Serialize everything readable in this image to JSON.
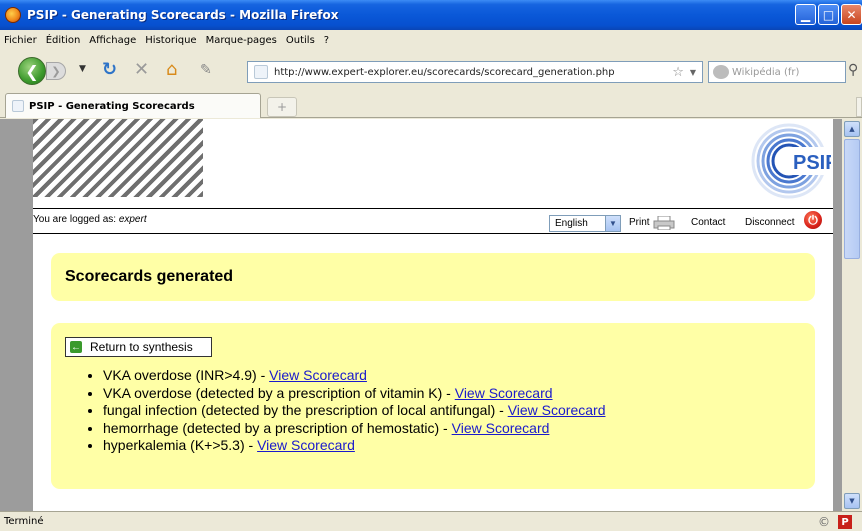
{
  "window": {
    "title": "PSIP - Generating Scorecards - Mozilla Firefox"
  },
  "menubar": {
    "items": [
      "Fichier",
      "Édition",
      "Affichage",
      "Historique",
      "Marque-pages",
      "Outils",
      "?"
    ]
  },
  "toolbar": {
    "url": "http://www.expert-explorer.eu/scorecards/scorecard_generation.php",
    "search_placeholder": "Wikipédia (fr)"
  },
  "tabs": [
    {
      "label": "PSIP - Generating Scorecards"
    }
  ],
  "tab_new_symbol": "+",
  "page": {
    "logo_text": "PSIP",
    "login_prefix": "You are logged as: ",
    "login_user": "expert",
    "language": "English",
    "print_label": "Print",
    "contact_label": "Contact",
    "disconnect_label": "Disconnect",
    "heading": "Scorecards generated",
    "return_label": "Return to synthesis",
    "scorecards": [
      {
        "text": "VKA overdose (INR>4.9) - ",
        "link": "View Scorecard"
      },
      {
        "text": "VKA overdose (detected by a prescription of vitamin K) - ",
        "link": "View Scorecard"
      },
      {
        "text": "fungal infection (detected by the prescription of local antifungal) - ",
        "link": "View Scorecard"
      },
      {
        "text": "hemorrhage (detected by a prescription of hemostatic) - ",
        "link": "View Scorecard"
      },
      {
        "text": "hyperkalemia (K+>5.3) - ",
        "link": "View Scorecard"
      }
    ]
  },
  "status": {
    "text": "Terminé"
  },
  "colors": {
    "panel_bg": "#ffffa6",
    "link": "#1a1acc",
    "titlebar": "#0a58d8"
  }
}
